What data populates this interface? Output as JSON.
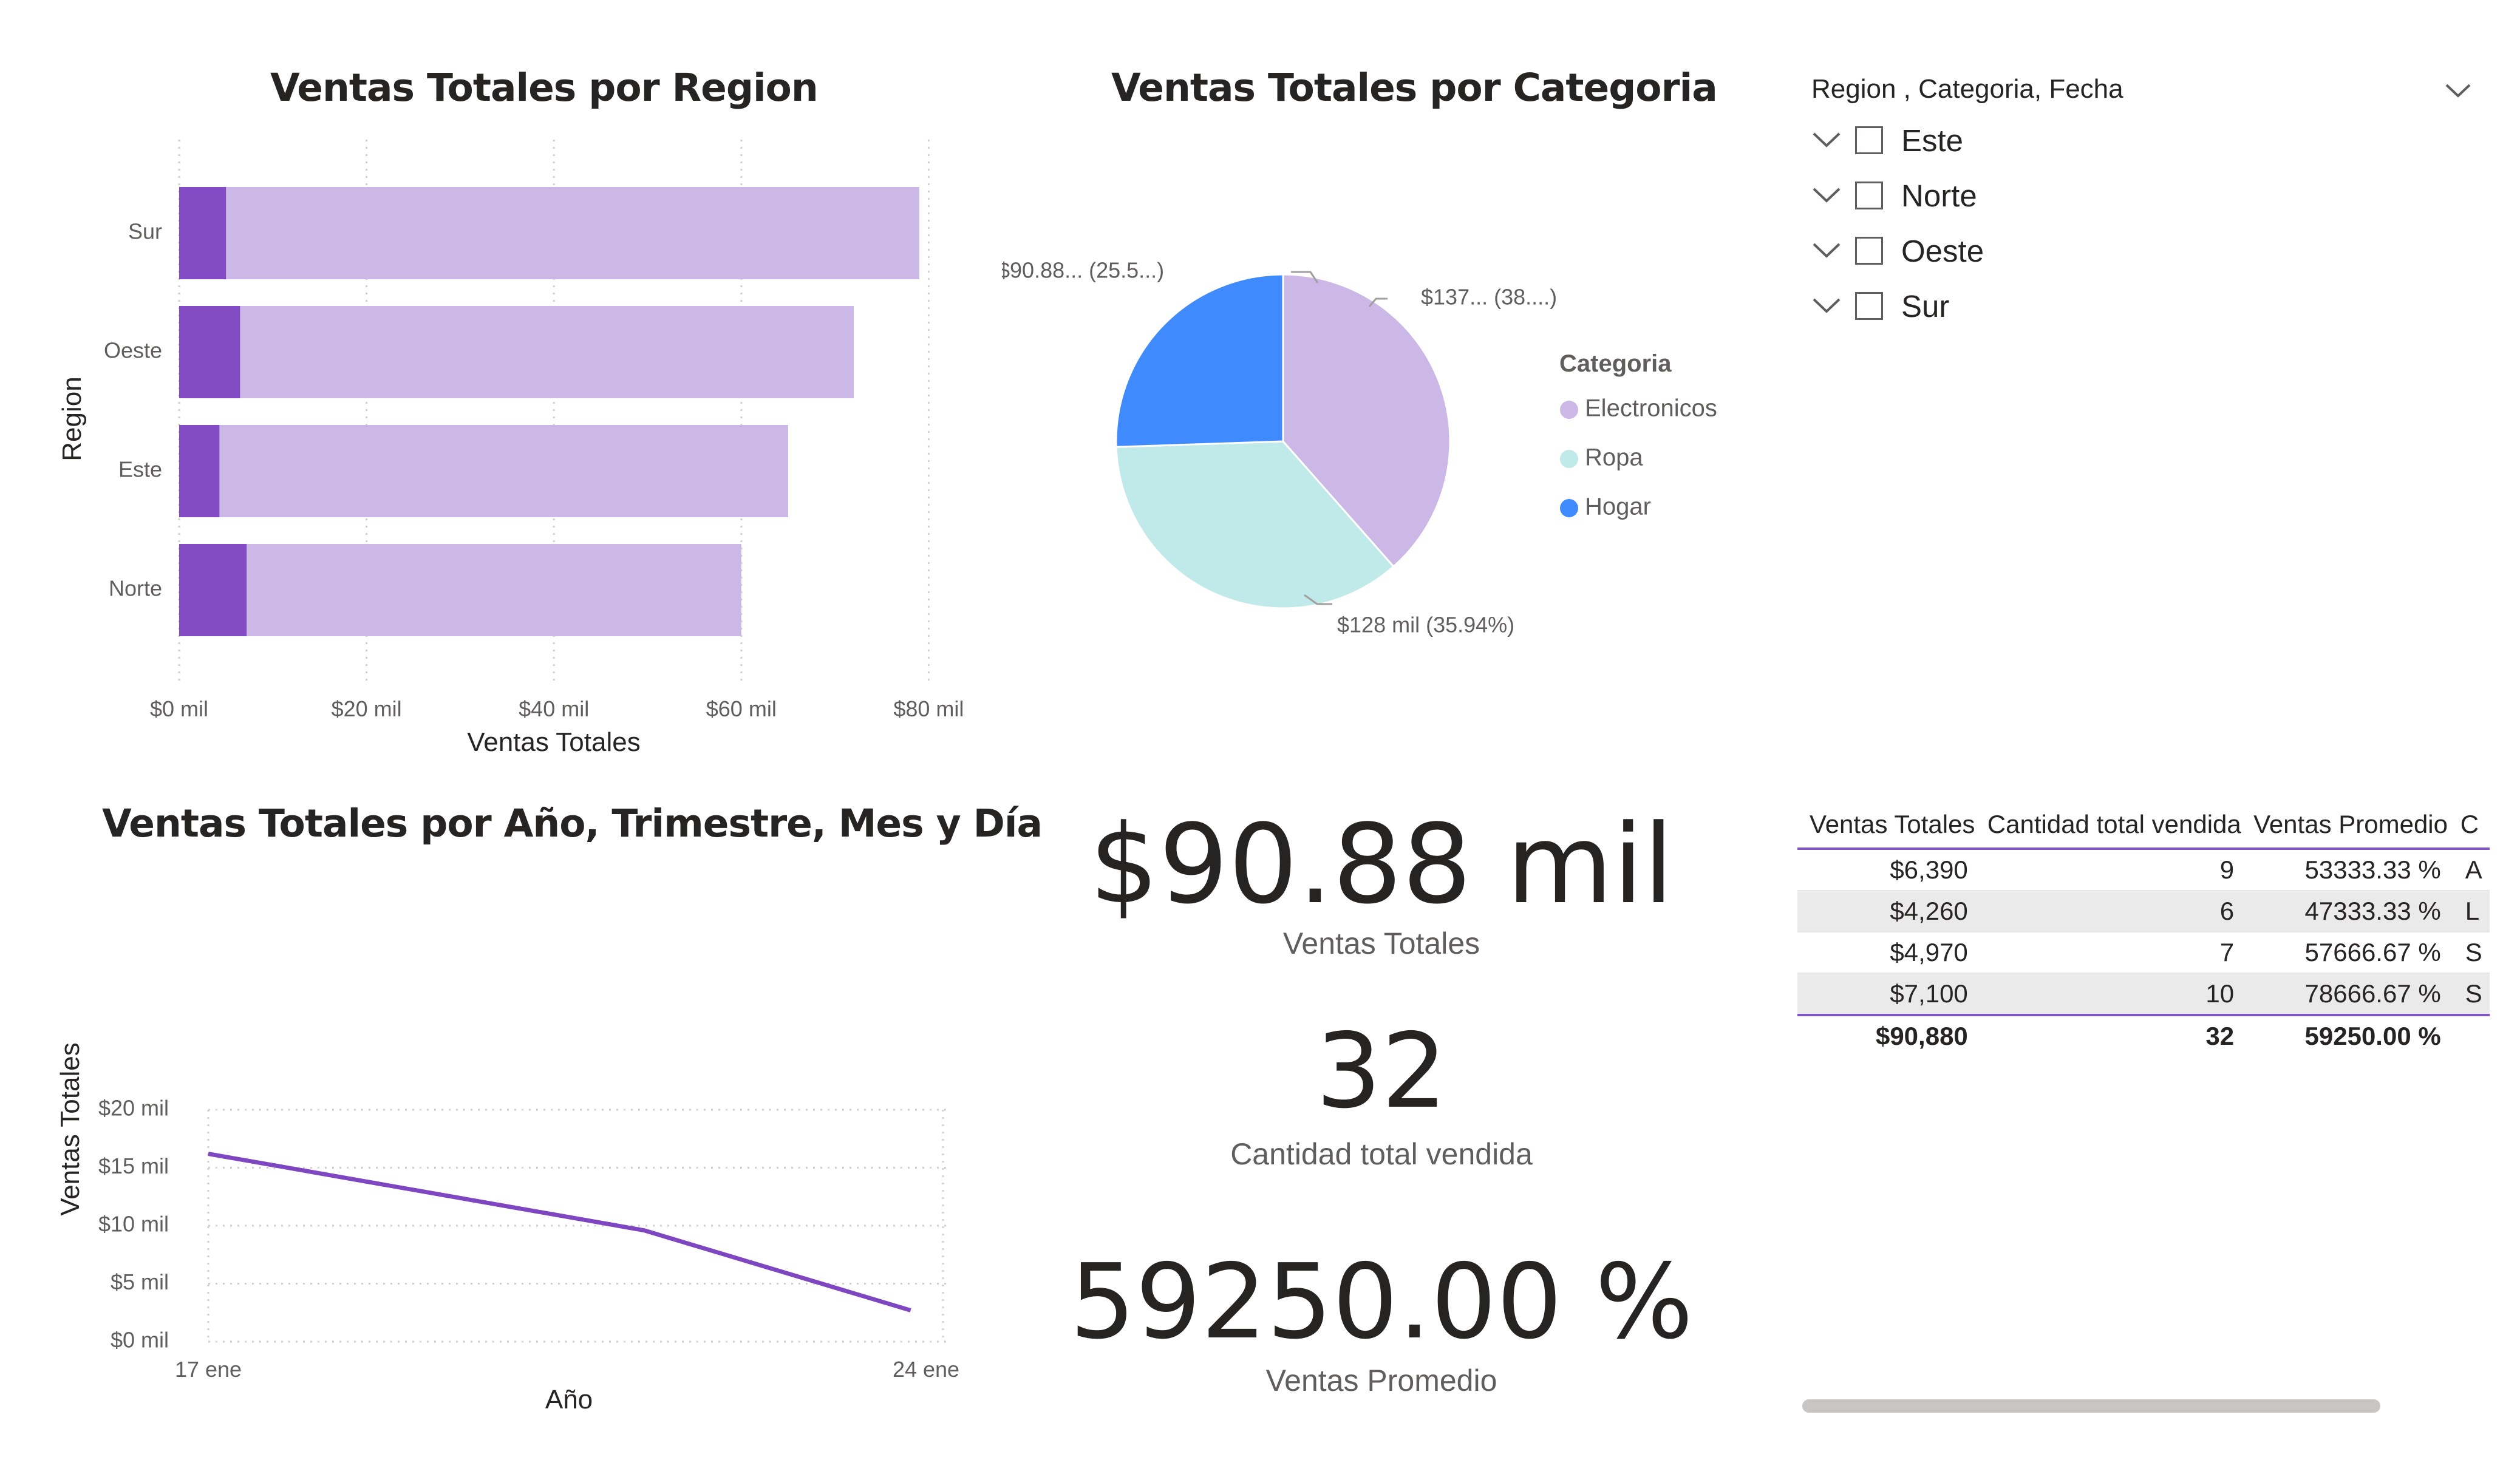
{
  "bar_chart": {
    "title": "Ventas Totales por Region",
    "xlabel": "Ventas Totales",
    "ylabel": "Region",
    "ticks": [
      "$0 mil",
      "$20 mil",
      "$40 mil",
      "$60 mil",
      "$80 mil"
    ]
  },
  "pie_chart": {
    "title": "Ventas Totales por Categoria",
    "legend_title": "Categoria",
    "labels": [
      "$137... (38....)",
      "$128 mil (35.94%)",
      "$90.88... (25.5...)"
    ]
  },
  "line_chart": {
    "title": "Ventas Totales por Año, Trimestre, Mes y Día",
    "xlabel": "Año",
    "ylabel": "Ventas Totales",
    "yticks": [
      "$0 mil",
      "$5 mil",
      "$10 mil",
      "$15 mil",
      "$20 mil"
    ],
    "xticks": [
      "17 ene",
      "24 ene"
    ]
  },
  "chart_data": [
    {
      "type": "bar",
      "orientation": "horizontal",
      "title": "Ventas Totales por Region",
      "xlabel": "Ventas Totales",
      "ylabel": "Region",
      "categories": [
        "Sur",
        "Oeste",
        "Este",
        "Norte"
      ],
      "series": [
        {
          "values": [
            5,
            6.5,
            4.3,
            7.2
          ]
        },
        {
          "values": [
            79,
            72,
            65,
            60
          ]
        }
      ],
      "xlim": [
        0,
        80
      ],
      "unit": "mil",
      "grid": "vertical dotted",
      "colors": [
        "#834bc4",
        "#cbb8e7"
      ]
    },
    {
      "type": "pie",
      "title": "Ventas Totales por Categoria",
      "legend_title": "Categoria",
      "legend_position": "right",
      "categories": [
        "Electronicos",
        "Ropa",
        "Hogar"
      ],
      "values": [
        137,
        128,
        90.88
      ],
      "percentages": [
        38.55,
        35.94,
        25.51
      ],
      "colors": [
        "#cbb8e7",
        "#bfeae9",
        "#3f8bfd"
      ]
    },
    {
      "type": "line",
      "title": "Ventas Totales por Año, Trimestre, Mes y Día",
      "xlabel": "Año",
      "ylabel": "Ventas Totales",
      "x": [
        "17 ene",
        "21 ene",
        "24 ene"
      ],
      "x_day": [
        17,
        21.25,
        23.85
      ],
      "y": [
        16.2,
        9.6,
        2.7
      ],
      "ylim": [
        0,
        20
      ],
      "xlim_day": [
        17,
        24
      ],
      "unit": "mil",
      "grid": "dotted",
      "color": "#7f46c2"
    }
  ],
  "slicer": {
    "header": "Region , Categoria, Fecha",
    "items": [
      "Este",
      "Norte",
      "Oeste",
      "Sur"
    ]
  },
  "cards": {
    "sales_value": "$90.88 mil",
    "sales_label": "Ventas Totales",
    "qty_value": "32",
    "qty_label": "Cantidad total vendida",
    "avg_value": "59250.00 %",
    "avg_label": "Ventas Promedio"
  },
  "table": {
    "headers": [
      "Ventas Totales",
      "Cantidad total vendida",
      "Ventas Promedio",
      "C"
    ],
    "rows": [
      [
        "$6,390",
        "9",
        "53333.33 %",
        "A"
      ],
      [
        "$4,260",
        "6",
        "47333.33 %",
        "L"
      ],
      [
        "$4,970",
        "7",
        "57666.67 %",
        "S"
      ],
      [
        "$7,100",
        "10",
        "78666.67 %",
        "S"
      ]
    ],
    "total": [
      "$90,880",
      "32",
      "59250.00 %",
      ""
    ]
  }
}
